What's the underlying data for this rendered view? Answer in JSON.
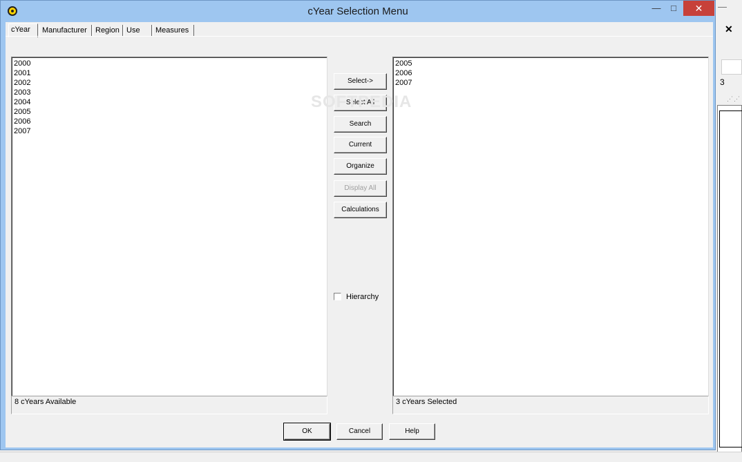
{
  "window": {
    "title": "cYear Selection Menu"
  },
  "title_buttons": {
    "minimize": "—",
    "maximize": "□",
    "close": "✕"
  },
  "tabs": [
    {
      "label": "cYear",
      "active": true
    },
    {
      "label": "Manufacturer"
    },
    {
      "label": "Region"
    },
    {
      "label": "Use"
    },
    {
      "label": "Measures"
    }
  ],
  "available": {
    "items": [
      "2000",
      "2001",
      "2002",
      "2003",
      "2004",
      "2005",
      "2006",
      "2007"
    ],
    "status": "8 cYears Available"
  },
  "selected": {
    "items": [
      "2005",
      "2006",
      "2007"
    ],
    "status": "3 cYears Selected"
  },
  "actions": {
    "select": "Select->",
    "select_all": "Select All",
    "search": "Search",
    "current": "Current",
    "organize": "Organize",
    "display_all": "Display All",
    "calculations": "Calculations"
  },
  "hierarchy": {
    "label": "Hierarchy",
    "checked": false
  },
  "footer": {
    "ok": "OK",
    "cancel": "Cancel",
    "help": "Help"
  },
  "background_window": {
    "close": "✕",
    "value": "3",
    "minimize": "—"
  },
  "watermark": "SOFTPEDIA"
}
